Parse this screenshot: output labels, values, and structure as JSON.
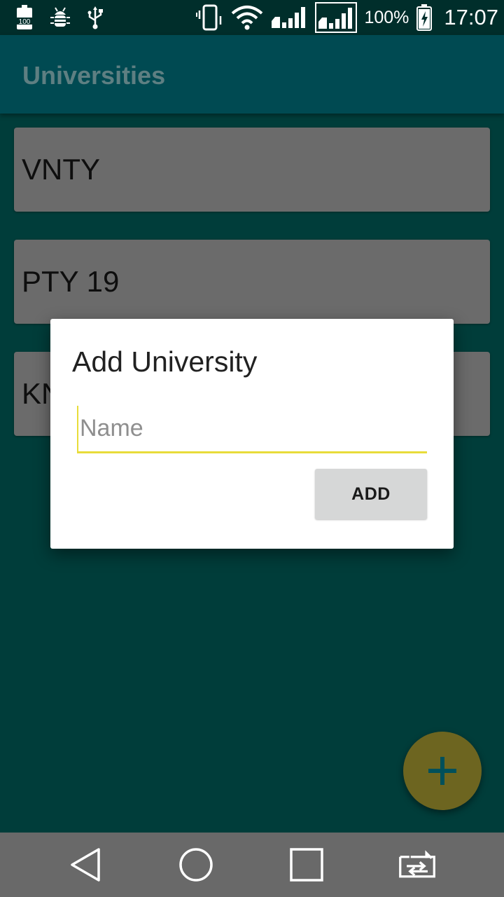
{
  "status_bar": {
    "battery_saver_text": "100",
    "battery_percent": "100%",
    "time": "17:07",
    "icons": [
      "battery-saver-icon",
      "android-debug-icon",
      "usb-icon",
      "vibrate-icon",
      "wifi-icon",
      "signal-sim1-icon",
      "signal-sim2-icon",
      "battery-charging-icon"
    ]
  },
  "app_bar": {
    "title": "Universities"
  },
  "list": {
    "items": [
      {
        "label": "VNTY"
      },
      {
        "label": "PTY 19"
      },
      {
        "label": "KN"
      }
    ]
  },
  "dialog": {
    "title": "Add University",
    "name_input": {
      "placeholder": "Name",
      "value": ""
    },
    "add_label": "ADD"
  },
  "fab": {
    "icon": "plus-icon"
  },
  "nav_bar": {
    "icons": [
      "back-icon",
      "home-icon",
      "recents-icon",
      "switch-apps-icon"
    ]
  },
  "colors": {
    "background": "#003d3a",
    "app_bar": "#004a52",
    "card": "#6b6b6b",
    "accent": "#e8dc3a",
    "fab": "#6d6520",
    "fab_icon": "#00505a"
  }
}
